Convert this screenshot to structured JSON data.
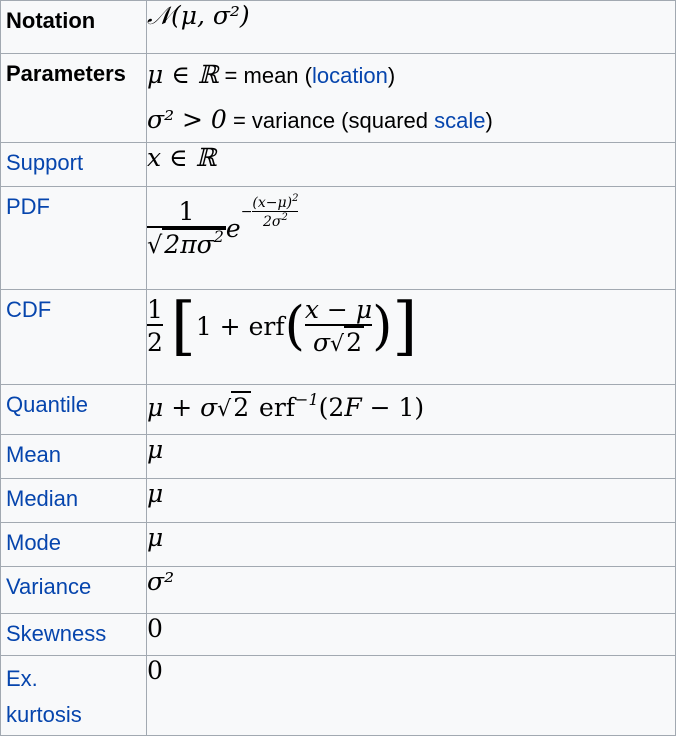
{
  "rows": {
    "notation": {
      "label": "Notation",
      "value": "𝒩(μ, σ²)"
    },
    "parameters": {
      "label": "Parameters",
      "line1_math": "μ ∈ ℝ",
      "line1_text": " = mean (",
      "line1_link": "location",
      "line1_close": ")",
      "line2_math": "σ² > 0",
      "line2_text": " = variance (squared ",
      "line2_link": "scale",
      "line2_close": ")"
    },
    "support": {
      "label": "Support",
      "value": "x ∈ ℝ"
    },
    "pdf": {
      "label": "PDF"
    },
    "cdf": {
      "label": "CDF"
    },
    "quantile": {
      "label": "Quantile"
    },
    "mean": {
      "label": "Mean",
      "value": "μ"
    },
    "median": {
      "label": "Median",
      "value": "μ"
    },
    "mode": {
      "label": "Mode",
      "value": "μ"
    },
    "variance": {
      "label": "Variance",
      "value": "σ²"
    },
    "skewness": {
      "label": "Skewness",
      "value": "0"
    },
    "kurtosis": {
      "label_line1": "Ex.",
      "label_line2": "kurtosis",
      "value": "0"
    }
  },
  "colors": {
    "link": "#0645ad",
    "border": "#a2a9b1",
    "background": "#f8f9fa"
  }
}
